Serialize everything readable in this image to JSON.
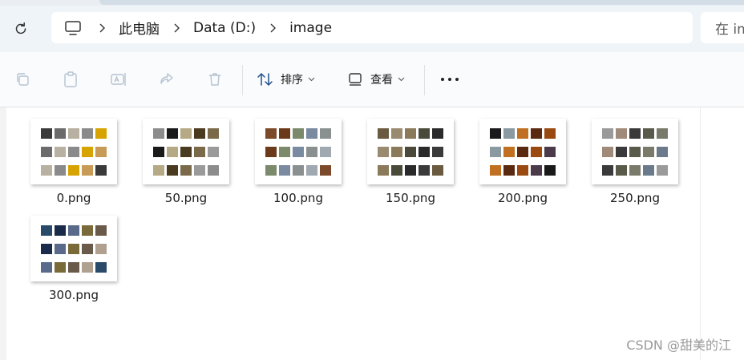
{
  "address_bar": {
    "breadcrumbs": [
      "此电脑",
      "Data (D:)",
      "image"
    ],
    "search_placeholder": "在 im"
  },
  "toolbar": {
    "sort_label": "排序",
    "view_label": "查看",
    "more_label": "..."
  },
  "icons": {
    "refresh": "refresh-icon",
    "computer": "computer-icon",
    "copy": "copy-icon",
    "paste": "paste-icon",
    "rename": "rename-icon",
    "share": "share-icon",
    "delete": "trash-icon"
  },
  "files": [
    {
      "name": "0.png",
      "palette": [
        "#3a3a3a",
        "#6b6b6b",
        "#b8b0a0",
        "#8a8a8a",
        "#d6a300",
        "#c79b55"
      ]
    },
    {
      "name": "50.png",
      "palette": [
        "#8c8c8c",
        "#1a1a1a",
        "#b5aa85",
        "#4a3a20",
        "#7a6a4a",
        "#9a9a9a"
      ]
    },
    {
      "name": "100.png",
      "palette": [
        "#7a4a2a",
        "#6a3a1a",
        "#7a8a6a",
        "#7a8aa0",
        "#8a9090",
        "#a0a8b0"
      ]
    },
    {
      "name": "150.png",
      "palette": [
        "#6a5a40",
        "#9a8a70",
        "#8a7a5a",
        "#4a4a3a",
        "#2a2a2a",
        "#3a3a3a"
      ]
    },
    {
      "name": "200.png",
      "palette": [
        "#1a1a1a",
        "#8a9aa0",
        "#c07020",
        "#5a2a10",
        "#9a4a10",
        "#4a3a4a"
      ]
    },
    {
      "name": "250.png",
      "palette": [
        "#9a9a9a",
        "#a08a7a",
        "#3a3a3a",
        "#5a5a4a",
        "#7a7a6a",
        "#6a7a8a"
      ]
    },
    {
      "name": "300.png",
      "palette": [
        "#2a4a6a",
        "#1a2a4a",
        "#5a6a8a",
        "#7a6a3a",
        "#6a5a4a",
        "#b0a090"
      ]
    }
  ],
  "watermark": "CSDN @甜美的江"
}
